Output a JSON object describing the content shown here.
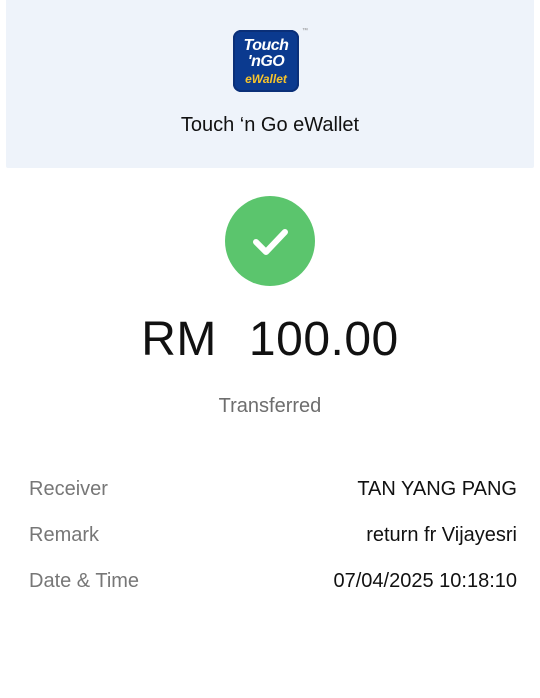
{
  "header": {
    "logo": {
      "line1": "Touch",
      "line2": "'nGO",
      "line3": "eWallet",
      "icon": "touch-n-go-logo",
      "colors": {
        "background": "#0b3a8f",
        "text": "#ffffff",
        "accent": "#f7c42b"
      }
    },
    "app_name": "Touch ‘n Go eWallet"
  },
  "status_icon": {
    "icon": "check-icon",
    "color": "#5bc56d"
  },
  "amount": {
    "currency": "RM",
    "value": "100.00"
  },
  "status_text": "Transferred",
  "details": {
    "receiver": {
      "label": "Receiver",
      "value": "TAN YANG PANG"
    },
    "remark": {
      "label": "Remark",
      "value": "return fr Vijayesri"
    },
    "datetime": {
      "label": "Date & Time",
      "value": "07/04/2025 10:18:10"
    }
  }
}
